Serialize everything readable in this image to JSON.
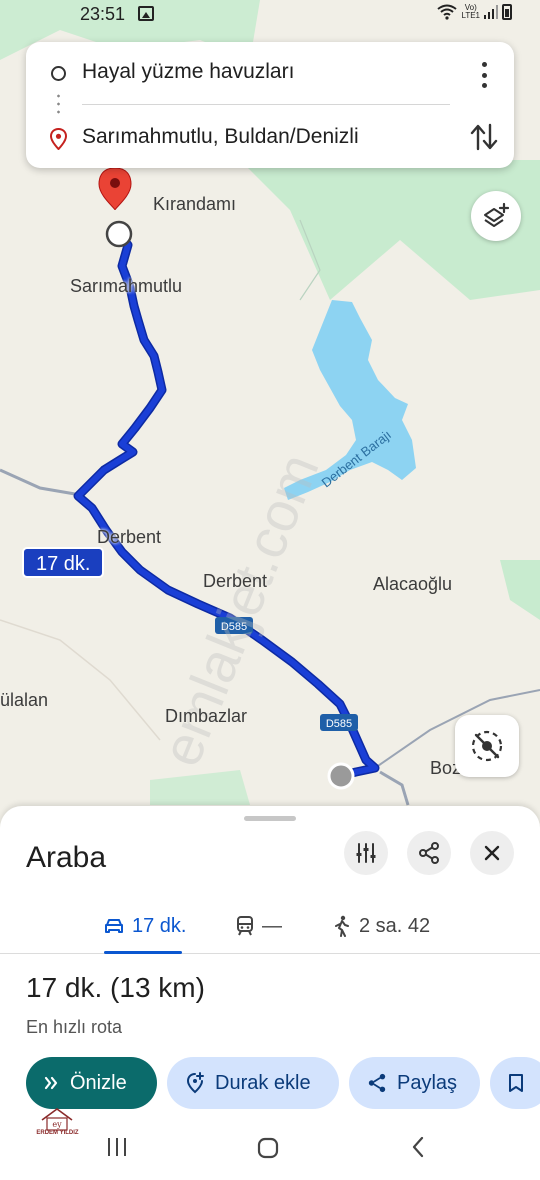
{
  "status_bar": {
    "time": "23:51",
    "network": "Vo) LTE1",
    "network_top": "Vo)",
    "network_bottom": "LTE1"
  },
  "search": {
    "origin": "Hayal yüzme havuzları",
    "destination": "Sarımahmutlu, Buldan/Denizli"
  },
  "map": {
    "labels": {
      "kirandami": "Kırandamı",
      "sarimahmutlu": "Sarımahmutlu",
      "derbent_1": "Derbent",
      "derbent_2": "Derbent",
      "alacaoglu": "Alacaoğlu",
      "ulalan": "ülalan",
      "dimbazlar": "Dımbazlar",
      "boz": "Boz",
      "derbent_barajı": "Derbent Barajı"
    },
    "road_shields": [
      "D585",
      "D585"
    ],
    "route_time_chip": "17 dk.",
    "watermark": "emlakjet.com",
    "colors": {
      "route": "#1a3fd6",
      "route_outline": "#0d2aa3",
      "water": "#8dd3f2",
      "park": "#c8ebcf",
      "land": "#f1efe7"
    }
  },
  "sheet": {
    "title": "Araba",
    "tabs": [
      {
        "icon": "car-icon",
        "label": "17 dk."
      },
      {
        "icon": "transit-icon",
        "label": "—"
      },
      {
        "icon": "walk-icon",
        "label": "2 sa. 42"
      }
    ],
    "summary": "17 dk. (13 km)",
    "subtitle": "En hızlı rota",
    "actions": {
      "preview": "Önizle",
      "add_stop": "Durak ekle",
      "share": "Paylaş"
    },
    "colors": {
      "accent": "#0b57d0",
      "primary_pill": "#0b6b6b",
      "secondary_pill": "#d3e3fd"
    }
  },
  "watermark_logo": {
    "name": "ERDEM YILDIZ"
  }
}
